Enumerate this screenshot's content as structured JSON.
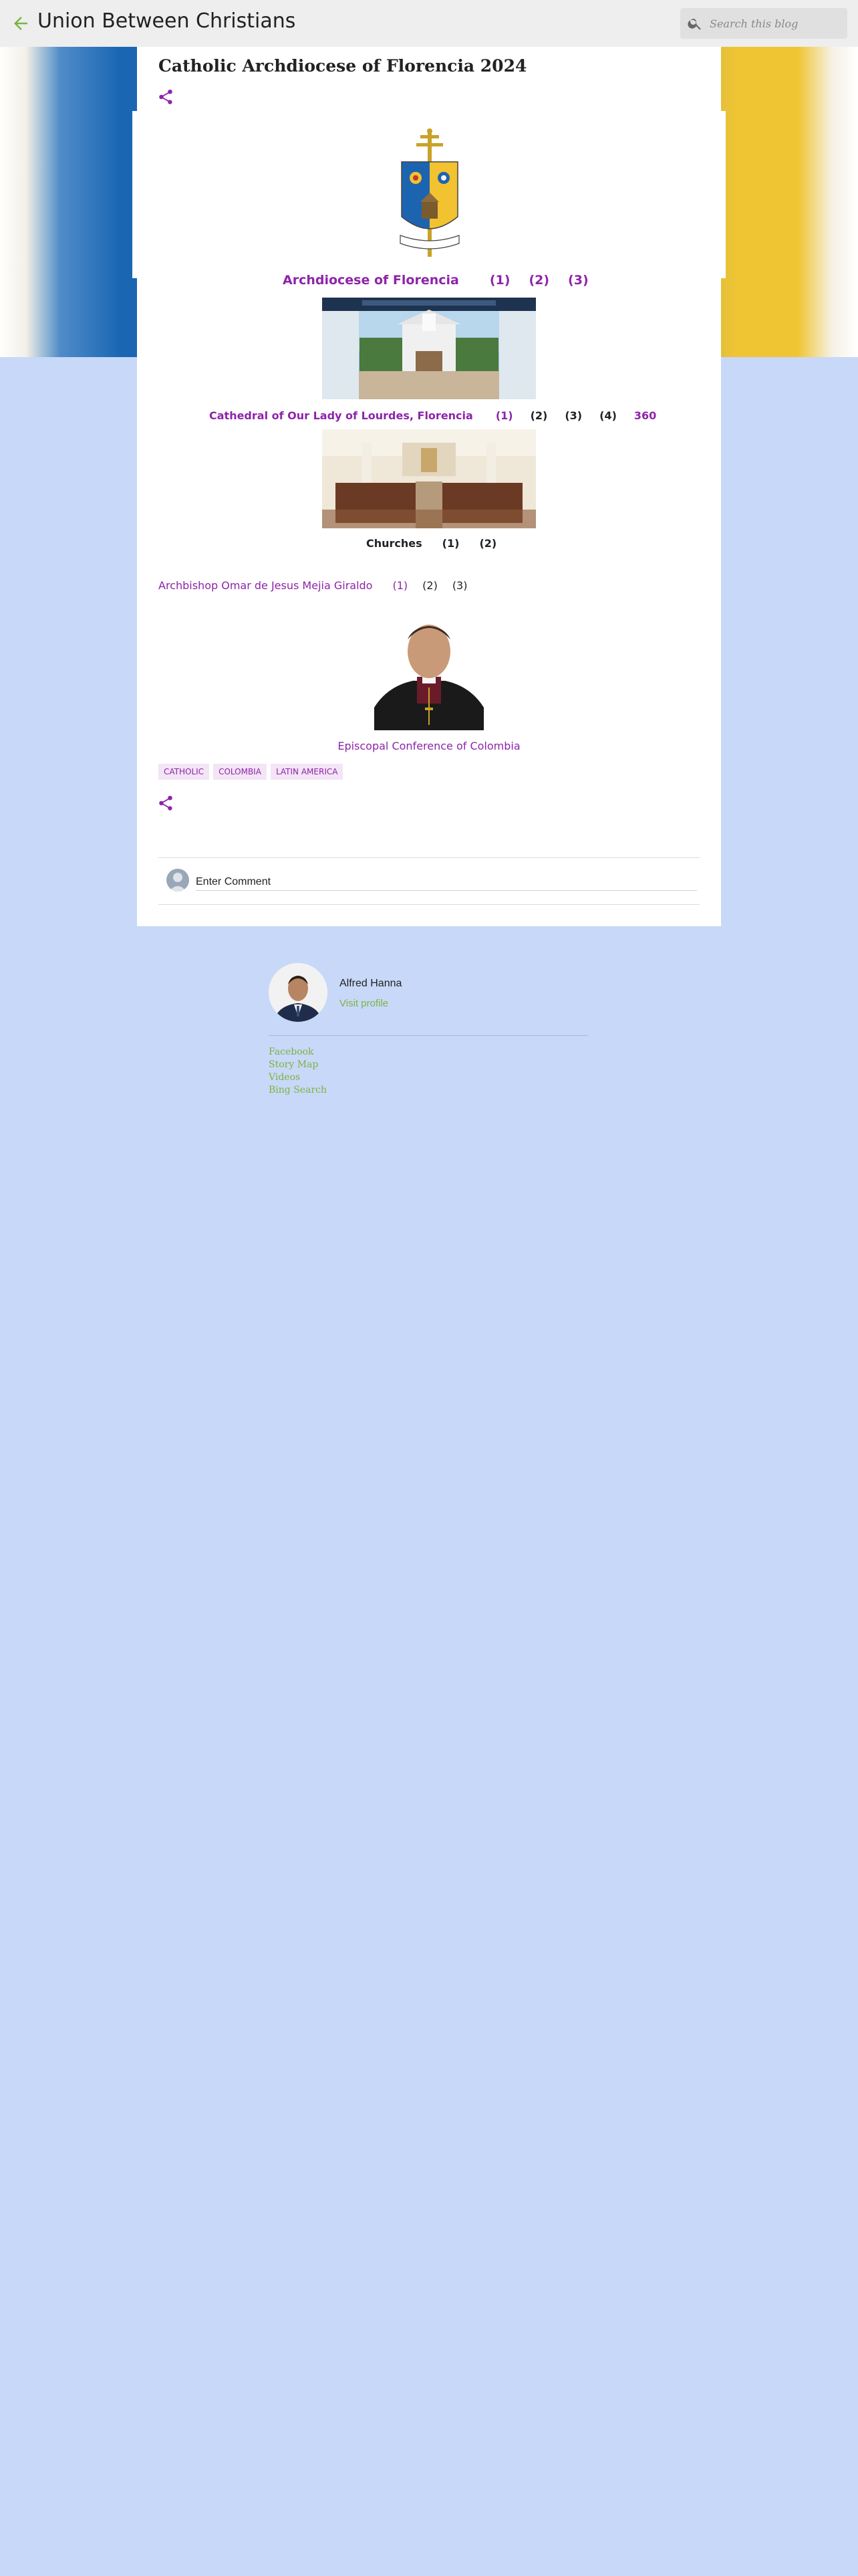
{
  "header": {
    "blog_title": "Union Between Christians",
    "search_placeholder": "Search this blog"
  },
  "post": {
    "title": "Catholic Archdiocese of Florencia 2024",
    "row1": [
      "Archdiocese of Florencia",
      "(1)",
      "(2)",
      "(3)"
    ],
    "row2_link": "Cathedral of Our Lady of Lourdes, Florencia",
    "row2_items": [
      "(1)",
      "(2)",
      "(3)",
      "(4)",
      "360"
    ],
    "row3": [
      "Churches",
      "(1)",
      "(2)"
    ],
    "row4_link": "Archbishop Omar de Jesus Mejia Giraldo",
    "row4_items": [
      "(1)",
      "(2)",
      "(3)"
    ],
    "conference_link": "Episcopal Conference of Colombia",
    "labels": [
      "CATHOLIC",
      "COLOMBIA",
      "LATIN AMERICA"
    ],
    "comment_placeholder": "Enter Comment"
  },
  "profile": {
    "name": "Alfred Hanna",
    "visit_label": "Visit profile",
    "links": [
      "Facebook",
      "Story Map",
      "Videos",
      "Bing Search"
    ]
  },
  "colors": {
    "accent_purple": "#8e24aa",
    "accent_green": "#7cb342",
    "page_background": "#c8d8f8"
  },
  "icons": {
    "back": "arrow-left-icon",
    "search": "search-icon",
    "share": "share-icon"
  }
}
